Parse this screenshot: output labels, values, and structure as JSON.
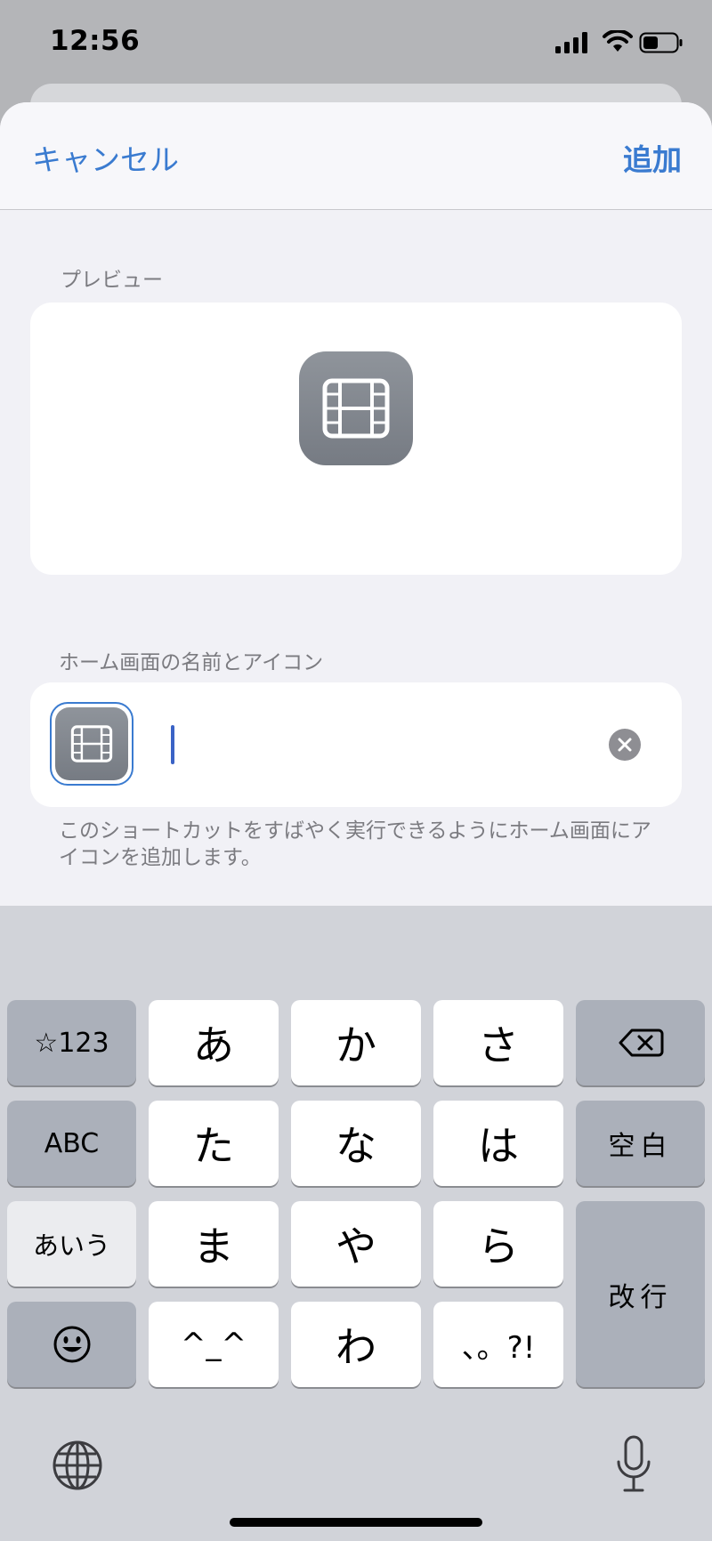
{
  "status_bar": {
    "time": "12:56"
  },
  "nav": {
    "cancel_label": "キャンセル",
    "add_label": "追加"
  },
  "preview": {
    "section_label": "プレビュー",
    "icon": "film-icon"
  },
  "name_section": {
    "section_label": "ホーム画面の名前とアイコン",
    "input_value": "",
    "icon": "film-icon",
    "description": "このショートカットをすばやく実行できるようにホーム画面にアイコンを追加します。"
  },
  "keyboard": {
    "row1": [
      "☆123",
      "あ",
      "か",
      "さ"
    ],
    "row2": [
      "ABC",
      "た",
      "な",
      "は",
      "空白"
    ],
    "row3": [
      "あいう",
      "ま",
      "や",
      "ら",
      "改行"
    ],
    "row4": [
      "^_^",
      "わ",
      "、。?!"
    ],
    "icons": {
      "delete": "backspace-icon",
      "emoji": "emoji-icon",
      "globe": "globe-icon",
      "mic": "microphone-icon"
    }
  }
}
